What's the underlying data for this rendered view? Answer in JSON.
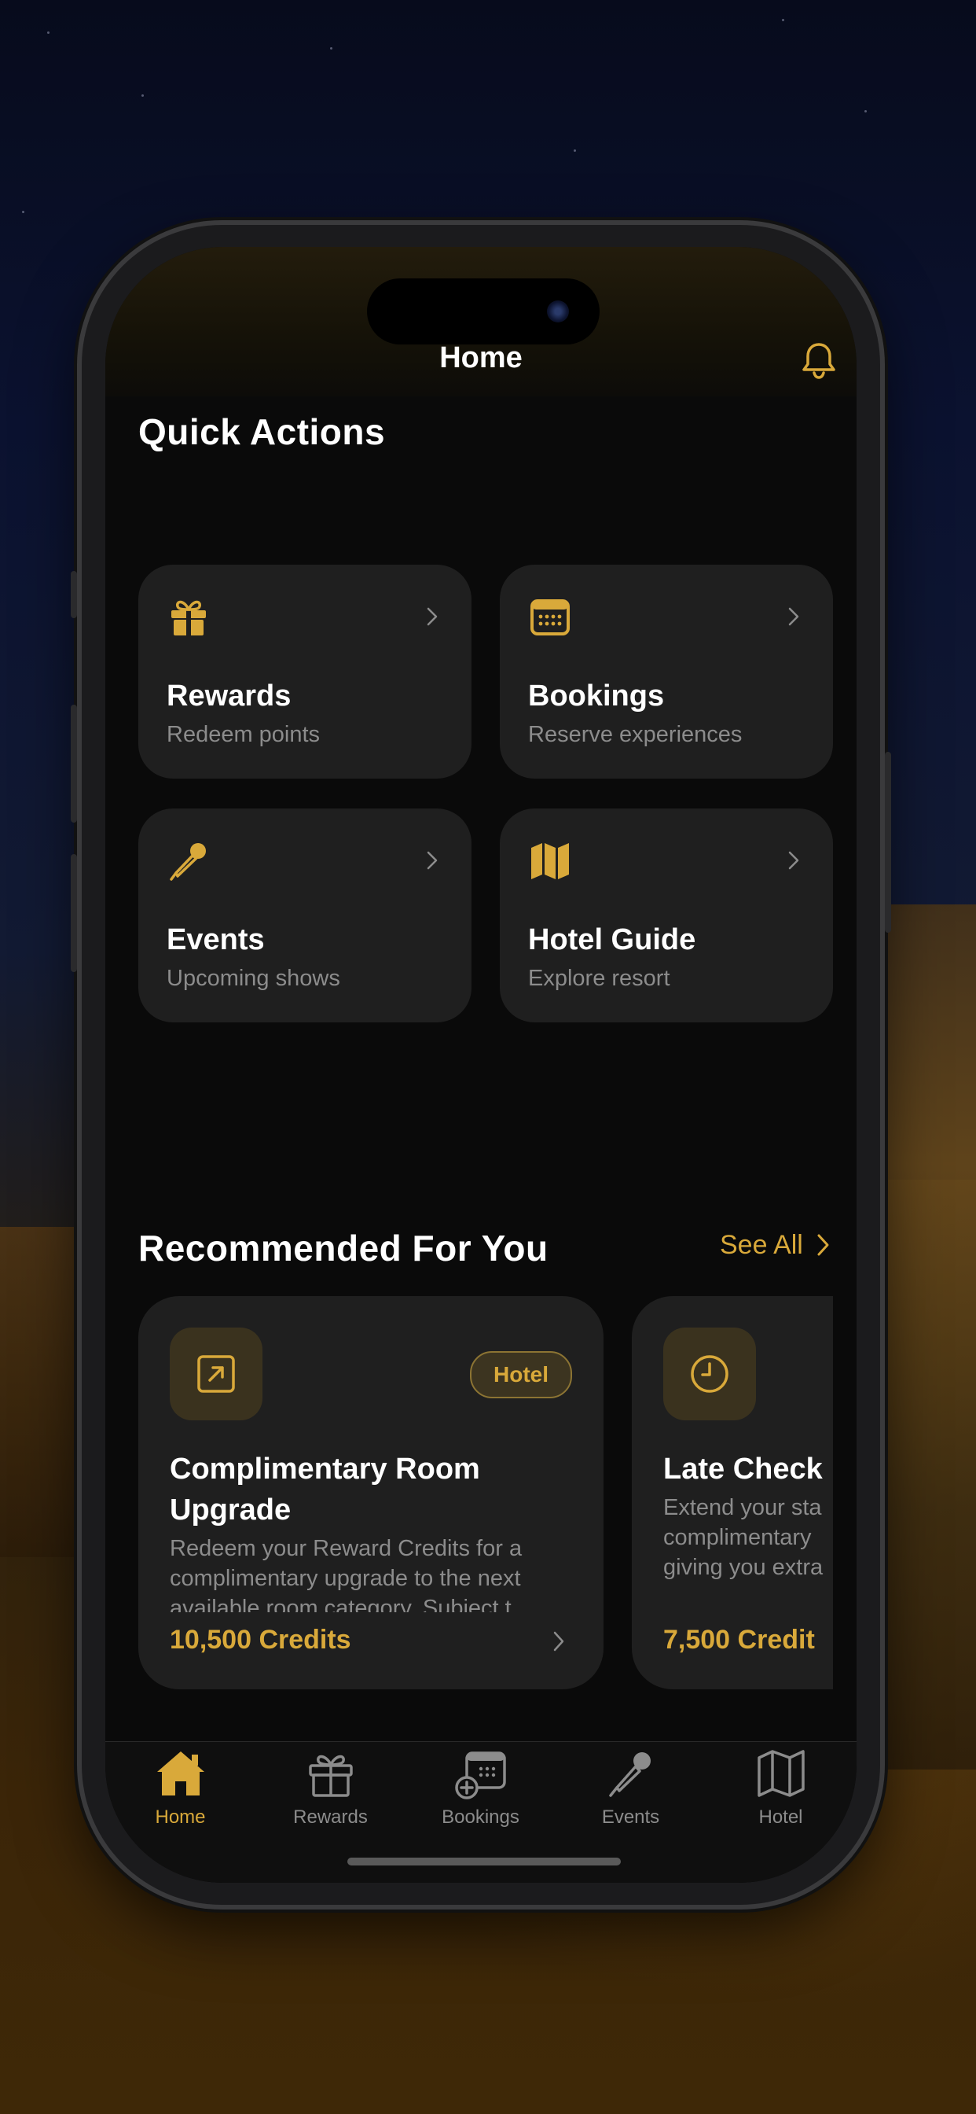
{
  "colors": {
    "accent": "#d9a93a",
    "card_bg": "#1f1f1f",
    "screen_bg": "#0a0a0a",
    "text_primary": "#ffffff",
    "text_secondary": "#8c8c8c"
  },
  "header": {
    "title": "Home",
    "notification_icon": "bell-icon"
  },
  "quick_actions": {
    "title": "Quick Actions",
    "items": [
      {
        "title": "Rewards",
        "subtitle": "Redeem points",
        "icon": "gift-icon"
      },
      {
        "title": "Bookings",
        "subtitle": "Reserve experiences",
        "icon": "calendar-icon"
      },
      {
        "title": "Events",
        "subtitle": "Upcoming shows",
        "icon": "microphone-icon"
      },
      {
        "title": "Hotel Guide",
        "subtitle": "Explore resort",
        "icon": "map-icon"
      }
    ]
  },
  "recommended": {
    "title": "Recommended For You",
    "see_all": "See All",
    "items": [
      {
        "icon": "arrow-up-right-square-icon",
        "badge": "Hotel",
        "title": "Complimentary Room Upgrade",
        "description": "Redeem your Reward Credits for a complimentary upgrade to the next available room category. Subject t...",
        "credits": "10,500 Credits"
      },
      {
        "icon": "clock-icon",
        "title": "Late Check",
        "description": "Extend your sta complimentary giving you extra",
        "credits": "7,500 Credit"
      }
    ]
  },
  "tabbar": {
    "items": [
      {
        "label": "Home",
        "icon": "home-icon",
        "active": true
      },
      {
        "label": "Rewards",
        "icon": "gift-icon",
        "active": false
      },
      {
        "label": "Bookings",
        "icon": "calendar-add-icon",
        "active": false
      },
      {
        "label": "Events",
        "icon": "microphone-icon",
        "active": false
      },
      {
        "label": "Hotel",
        "icon": "map-icon",
        "active": false
      }
    ]
  }
}
